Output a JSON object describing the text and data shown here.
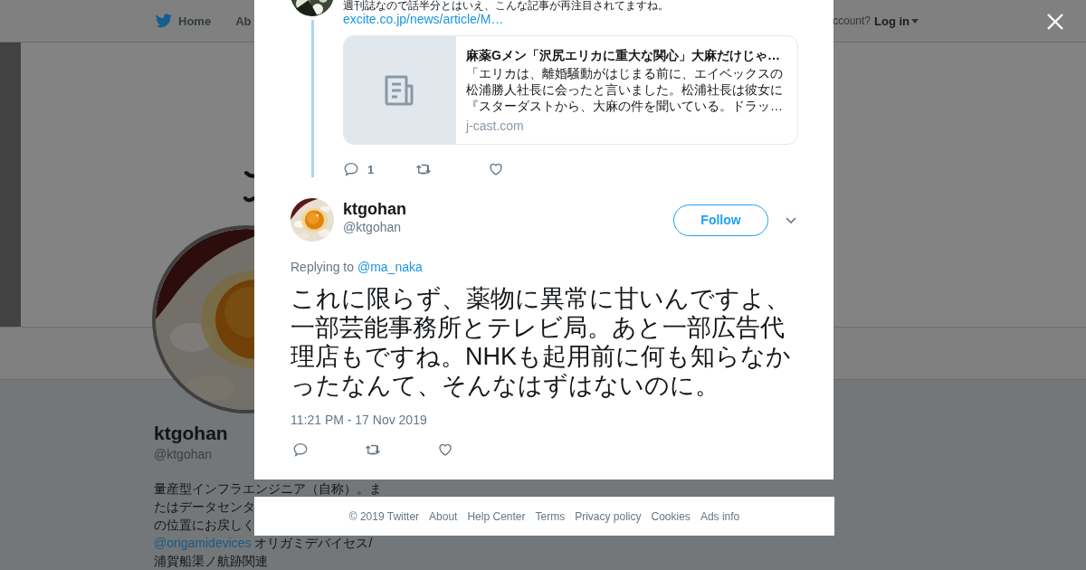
{
  "top_nav": {
    "items": [
      {
        "label": "Home"
      },
      {
        "label": "Ab"
      }
    ],
    "account_prompt": "ccount?",
    "login": "Log in"
  },
  "profile": {
    "name": "ktgohan",
    "handle": "@ktgohan",
    "bio_lines": [
      {
        "text": "量産型インフラエンジニア（自称）。ま"
      },
      {
        "text": "たはデータセンタ"
      },
      {
        "text": "の位置にお戻しく"
      },
      {
        "mention": "@origamidevices",
        "text": "オリガミデバイセス/"
      },
      {
        "text": "浦賀船渠ノ航跡関連"
      }
    ]
  },
  "modal": {
    "previous_tweet": {
      "text": "週刊誌なので話半分とはいえ、こんな記事が再注目されてますね。",
      "link": "excite.co.jp/news/article/M…",
      "card": {
        "title": "麻薬Gメン「沢尻エリカに重大な関心」大麻だけじゃ…",
        "description": "「エリカは、離婚騒動がはじまる前に、エイベックスの松浦勝人社長に会ったと言いました。松浦社長は彼女に『スターダストから、大麻の件を聞いている。ドラッ…",
        "domain": "j-cast.com"
      },
      "reply_count": "1"
    },
    "tweet": {
      "name": "ktgohan",
      "handle": "@ktgohan",
      "follow_label": "Follow",
      "replying_label": "Replying to",
      "replying_to": "@ma_naka",
      "text": "これに限らず、薬物に異常に甘いんですよ、一部芸能事務所とテレビ局。あと一部広告代理店もですね。NHKも起用前に何も知らなかったなんて、そんなはずはないのに。",
      "timestamp": "11:21 PM - 17 Nov 2019"
    }
  },
  "footer": {
    "copyright": "© 2019 Twitter",
    "links": [
      "About",
      "Help Center",
      "Terms",
      "Privacy policy",
      "Cookies",
      "Ads info"
    ]
  }
}
